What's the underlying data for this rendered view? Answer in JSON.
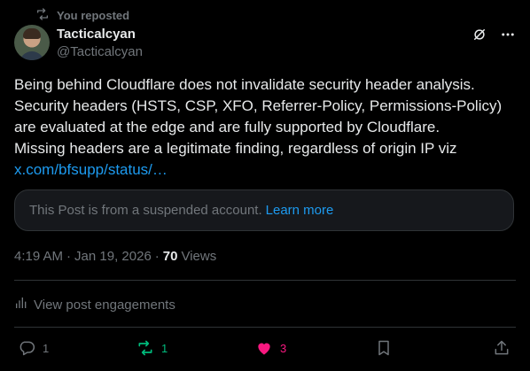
{
  "repost": {
    "label": "You reposted",
    "icon": "repost-icon"
  },
  "author": {
    "display_name": "Tacticalcyan",
    "handle": "@Tacticalcyan",
    "avatar_icon": "avatar"
  },
  "top_actions": {
    "grok_icon": "grok-icon",
    "more_icon": "more-icon"
  },
  "post": {
    "lines": [
      "Being behind Cloudflare does not invalidate security header analysis.",
      "Security headers (HSTS, CSP, XFO, Referrer-Policy, Permissions-Policy)",
      "are evaluated at the edge and are fully supported by Cloudflare.",
      "Missing headers are a legitimate finding, regardless of origin IP viz"
    ],
    "link": "x.com/bfsupp/status/…"
  },
  "suspended": {
    "text": "This Post is from a suspended account.",
    "learn_more": "Learn more"
  },
  "meta": {
    "time": "4:19 AM",
    "date": "Jan 19, 2026",
    "separator": "·",
    "views_count": "70",
    "views_label": "Views"
  },
  "engagements_label": "View post engagements",
  "actions": {
    "reply_count": "1",
    "repost_count": "1",
    "like_count": "3"
  },
  "colors": {
    "background": "#000000",
    "text": "#e7e9ea",
    "muted": "#71767b",
    "link": "#1d9bf0",
    "repost_active": "#00ba7c",
    "like_active": "#f91880"
  }
}
